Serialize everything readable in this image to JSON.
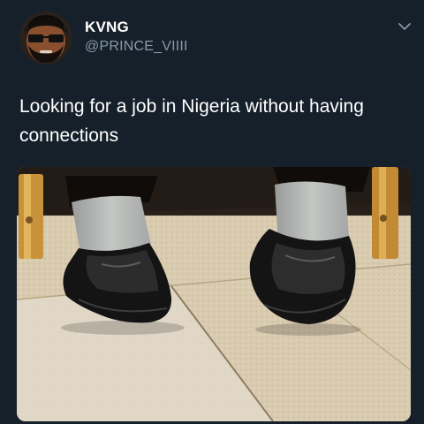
{
  "tweet": {
    "display_name": "KVNG",
    "handle": "@PRINCE_VIIII",
    "text": "Looking for a job in Nigeria without having connections",
    "avatar_icon": "avatar-cartoon-face",
    "menu_icon": "chevron-down-icon"
  },
  "colors": {
    "background": "#15202b",
    "text_primary": "#ffffff",
    "text_secondary": "#8899a6"
  }
}
